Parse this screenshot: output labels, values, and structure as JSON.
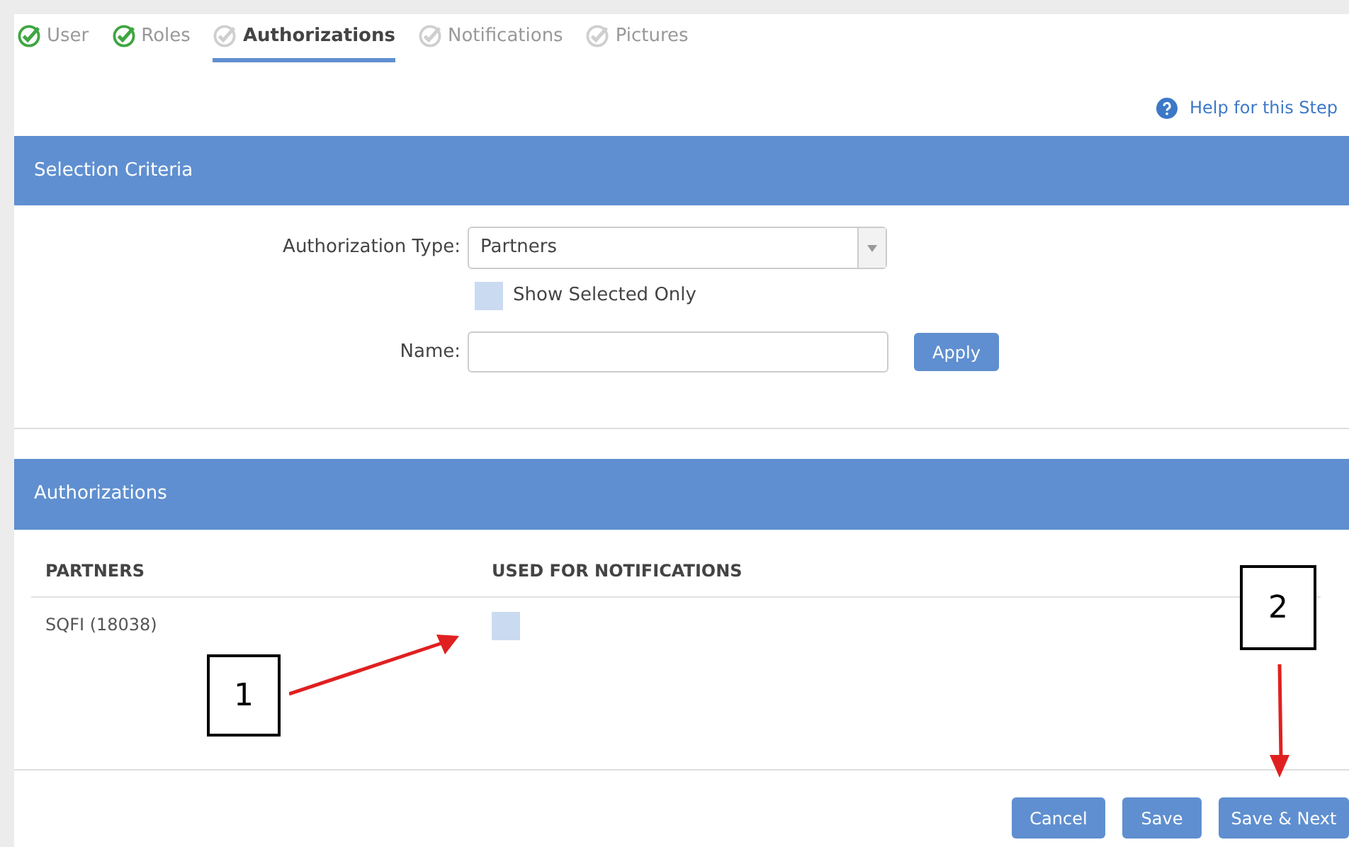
{
  "steps": [
    {
      "label": "User",
      "done": true,
      "selected": false
    },
    {
      "label": "Roles",
      "done": true,
      "selected": false
    },
    {
      "label": "Authorizations",
      "done": false,
      "selected": true
    },
    {
      "label": "Notifications",
      "done": false,
      "selected": false
    },
    {
      "label": "Pictures",
      "done": false,
      "selected": false
    }
  ],
  "help_link": "Help for this Step",
  "selection_criteria": {
    "title": "Selection Criteria",
    "type_label": "Authorization Type:",
    "type_value": "Partners",
    "show_selected_only": {
      "label": "Show Selected Only",
      "checked": false
    },
    "name_label": "Name:",
    "apply": "Apply"
  },
  "authorizations": {
    "title": "Authorizations",
    "columns": [
      "PARTNERS",
      "USED FOR NOTIFICATIONS"
    ],
    "rows": [
      {
        "partner": "SQFI (18038)",
        "used_for_notifications": false
      }
    ]
  },
  "buttons": [
    "Cancel",
    "Save",
    "Save & Next"
  ],
  "annotations": [
    {
      "label": "1"
    },
    {
      "label": "2"
    }
  ]
}
